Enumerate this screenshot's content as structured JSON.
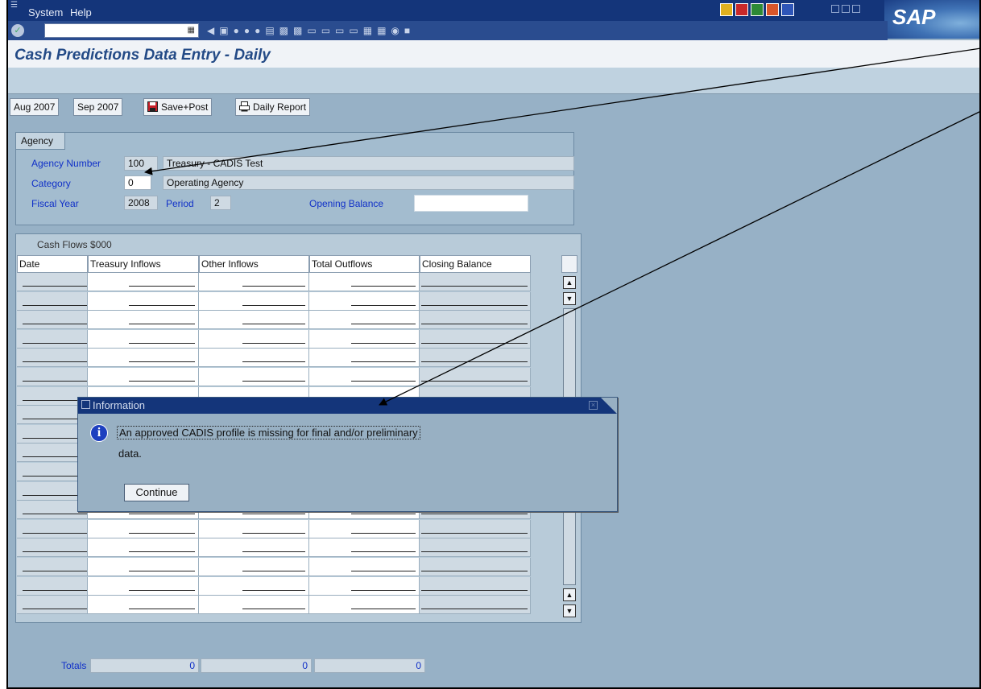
{
  "menu": {
    "system": "System",
    "help": "Help"
  },
  "title": "Cash Predictions Data Entry - Daily",
  "app_buttons": {
    "aug": "Aug 2007",
    "sep": "Sep 2007",
    "save_post": "Save+Post",
    "daily_report": "Daily Report"
  },
  "agency": {
    "tab_label": "Agency",
    "agency_number_label": "Agency Number",
    "agency_number": "100",
    "agency_name": "Treasury - CADIS Test",
    "category_label": "Category",
    "category": "0",
    "category_name": "Operating Agency",
    "fiscal_year_label": "Fiscal Year",
    "fiscal_year": "2008",
    "period_label": "Period",
    "period": "2",
    "opening_balance_label": "Opening Balance",
    "opening_balance": ""
  },
  "cash_flows": {
    "caption": "Cash Flows $000",
    "columns": [
      "Date",
      "Treasury Inflows",
      "Other Inflows",
      "Total Outflows",
      "Closing Balance"
    ]
  },
  "totals": {
    "label": "Totals",
    "treasury_inflows": "0",
    "other_inflows": "0",
    "total_outflows": "0"
  },
  "dialog": {
    "title": "Information",
    "message_line1": "An approved CADIS profile is missing for final and/or preliminary",
    "message_line2": "data.",
    "continue_label": "Continue"
  },
  "logo": "SAP",
  "icons": {
    "check": "checkmark-icon",
    "save": "floppy-save-icon",
    "print": "printer-icon",
    "info": "info-icon"
  },
  "colors": {
    "header_blue": "#14357a",
    "label_blue": "#1030c8",
    "panel_bg": "#97b1c6",
    "title_text": "#234a86"
  }
}
